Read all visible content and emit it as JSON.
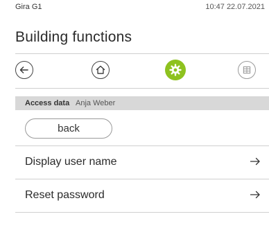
{
  "status_bar": {
    "device": "Gira G1",
    "datetime": "10:47 22.07.2021"
  },
  "page": {
    "title": "Building functions"
  },
  "nav": {
    "back_icon": "arrow-left-icon",
    "home_icon": "home-icon",
    "settings_icon": "gear-icon",
    "grid_icon": "grid-icon",
    "active": "settings",
    "accent_color": "#8ec21f"
  },
  "breadcrumb": {
    "label": "Access data",
    "user": "Anja Weber"
  },
  "back_button": {
    "label": "back"
  },
  "menu": {
    "items": [
      {
        "label": "Display user name",
        "icon": "arrow-right-icon"
      },
      {
        "label": "Reset password",
        "icon": "arrow-right-icon"
      }
    ]
  }
}
